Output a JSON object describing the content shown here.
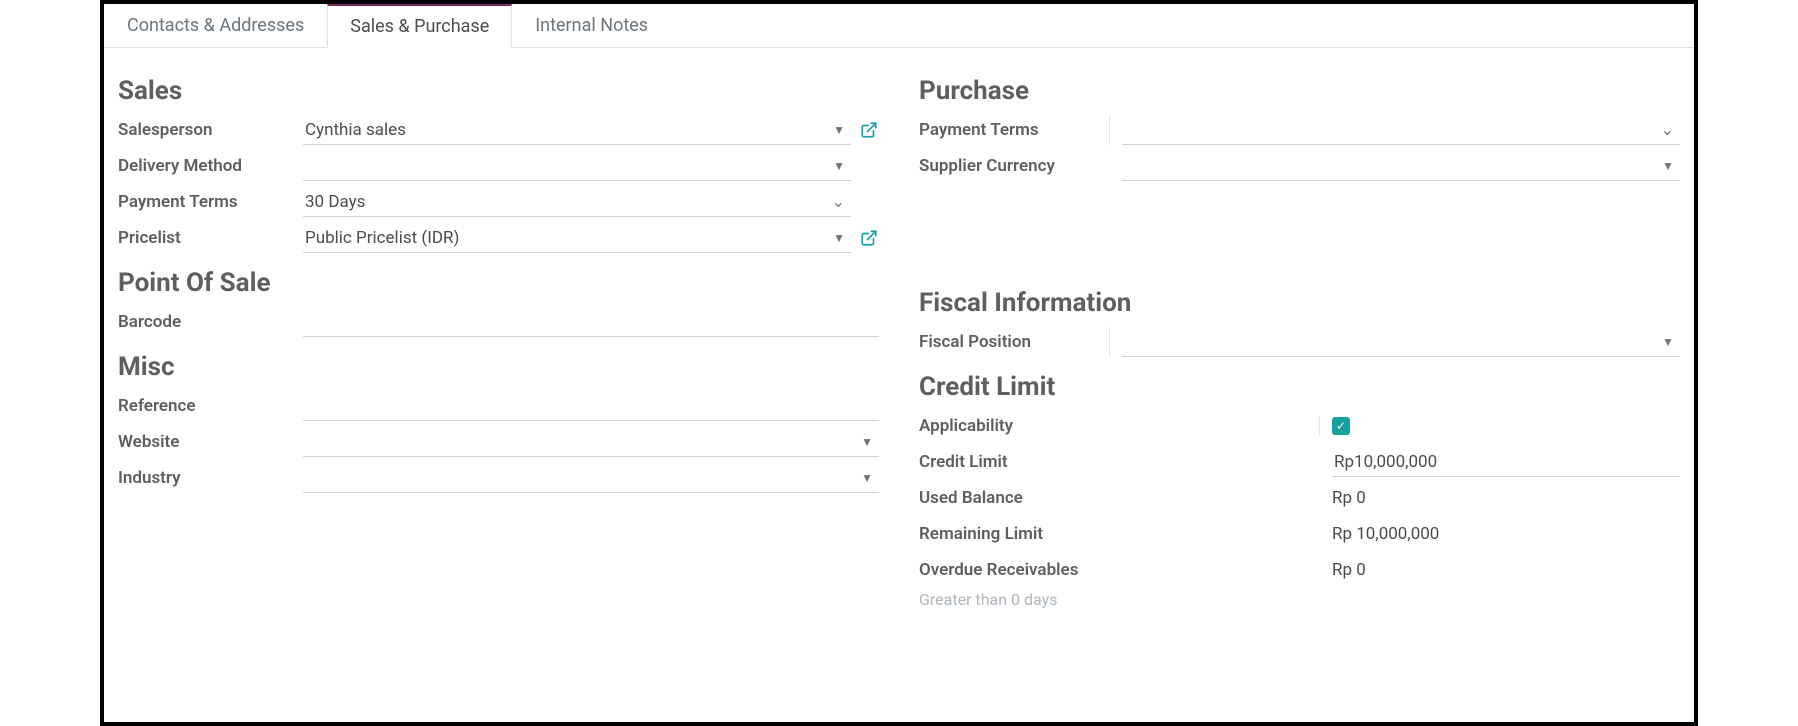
{
  "tabs": {
    "contacts": "Contacts & Addresses",
    "sales": "Sales & Purchase",
    "notes": "Internal Notes"
  },
  "sales": {
    "title": "Sales",
    "salesperson_label": "Salesperson",
    "salesperson_value": "Cynthia sales",
    "delivery_label": "Delivery Method",
    "delivery_value": "",
    "payment_label": "Payment Terms",
    "payment_value": "30 Days",
    "pricelist_label": "Pricelist",
    "pricelist_value": "Public Pricelist (IDR)"
  },
  "pos": {
    "title": "Point Of Sale",
    "barcode_label": "Barcode",
    "barcode_value": ""
  },
  "misc": {
    "title": "Misc",
    "reference_label": "Reference",
    "reference_value": "",
    "website_label": "Website",
    "website_value": "",
    "industry_label": "Industry",
    "industry_value": ""
  },
  "purchase": {
    "title": "Purchase",
    "payment_label": "Payment Terms",
    "payment_value": "",
    "currency_label": "Supplier Currency",
    "currency_value": ""
  },
  "fiscal": {
    "title": "Fiscal Information",
    "position_label": "Fiscal Position",
    "position_value": ""
  },
  "credit": {
    "title": "Credit Limit",
    "applicability_label": "Applicability",
    "limit_label": "Credit Limit",
    "limit_value": "Rp10,000,000",
    "used_label": "Used Balance",
    "used_value": "Rp 0",
    "remaining_label": "Remaining Limit",
    "remaining_value": "Rp 10,000,000",
    "overdue_label": "Overdue Receivables",
    "overdue_value": "Rp 0",
    "note": "Greater than 0 days"
  }
}
